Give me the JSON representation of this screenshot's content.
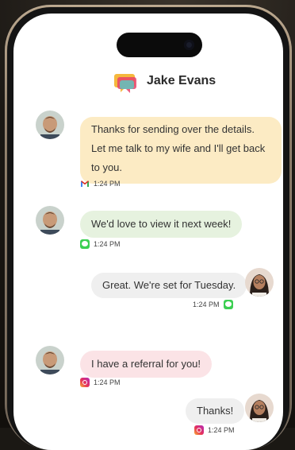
{
  "conversation": {
    "contact_name": "Jake Evans"
  },
  "messages": [
    {
      "sender": "contact",
      "text_lines": [
        "Thanks for sending over the details.",
        "Let me talk to my wife and I'll get back",
        "to you."
      ],
      "time": "1:24 PM",
      "channel_icon": "gmail-icon",
      "bubble_color": "#fcebc4"
    },
    {
      "sender": "contact",
      "text": "We'd love to view it next week!",
      "time": "1:24 PM",
      "channel_icon": "imessage-icon",
      "bubble_color": "#e6f2df"
    },
    {
      "sender": "user",
      "text": "Great. We're set for Tuesday.",
      "time": "1:24 PM",
      "channel_icon": "imessage-icon",
      "bubble_color": "#efefef"
    },
    {
      "sender": "contact",
      "text": "I have a referral for you!",
      "time": "1:24 PM",
      "channel_icon": "instagram-icon",
      "bubble_color": "#fbe3e6"
    },
    {
      "sender": "user",
      "text": "Thanks!",
      "time": "1:24 PM",
      "channel_icon": "instagram-icon",
      "bubble_color": "#efefef"
    }
  ]
}
